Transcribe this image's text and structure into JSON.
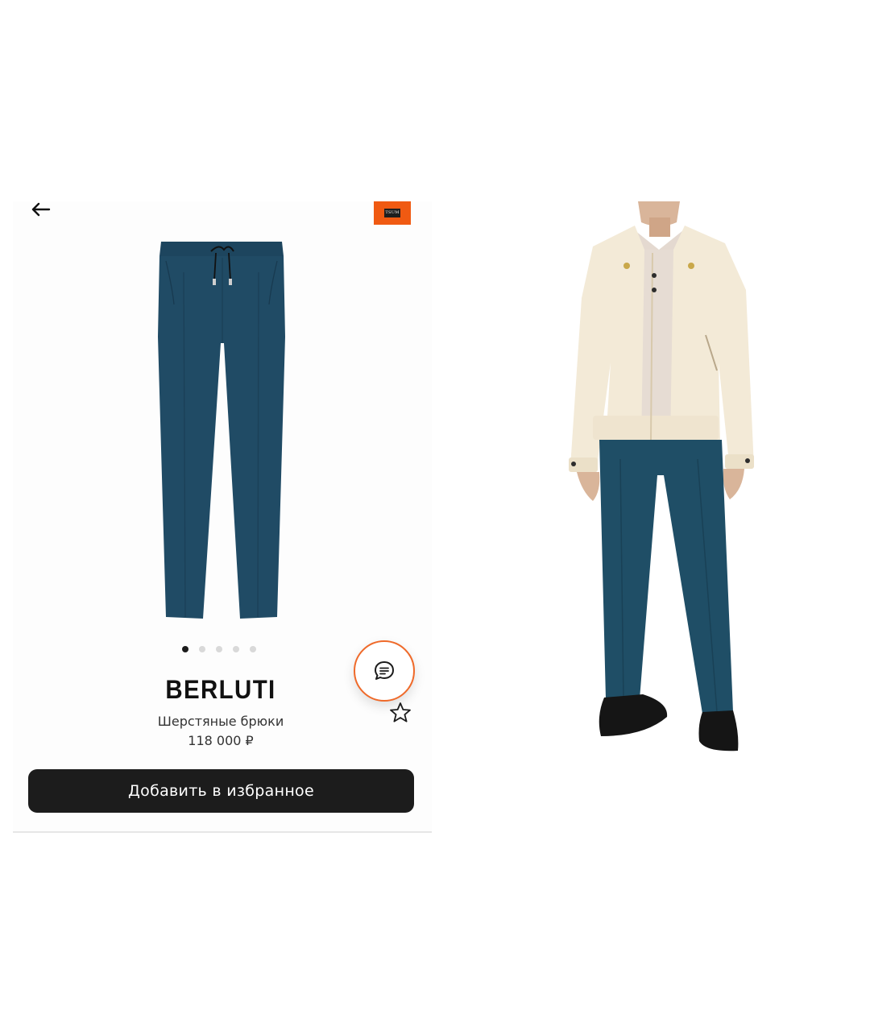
{
  "header": {
    "back_icon": "arrow-left-icon",
    "store_badge_text": "TSUM"
  },
  "product": {
    "brand": "BERLUTI",
    "name": "Шерстяные брюки",
    "price": "118 000 ₽",
    "carousel": {
      "total": 5,
      "active": 1
    },
    "color": "#1f4a64"
  },
  "actions": {
    "chat_icon": "chat-bubble-icon",
    "favorite_icon": "star-outline-icon",
    "add_to_favorites_label": "Добавить в избранное"
  },
  "colors": {
    "accent": "#f05a12",
    "button_bg": "#1c1c1c",
    "trousers": "#1f4a64",
    "jacket": "#f3ead7"
  }
}
